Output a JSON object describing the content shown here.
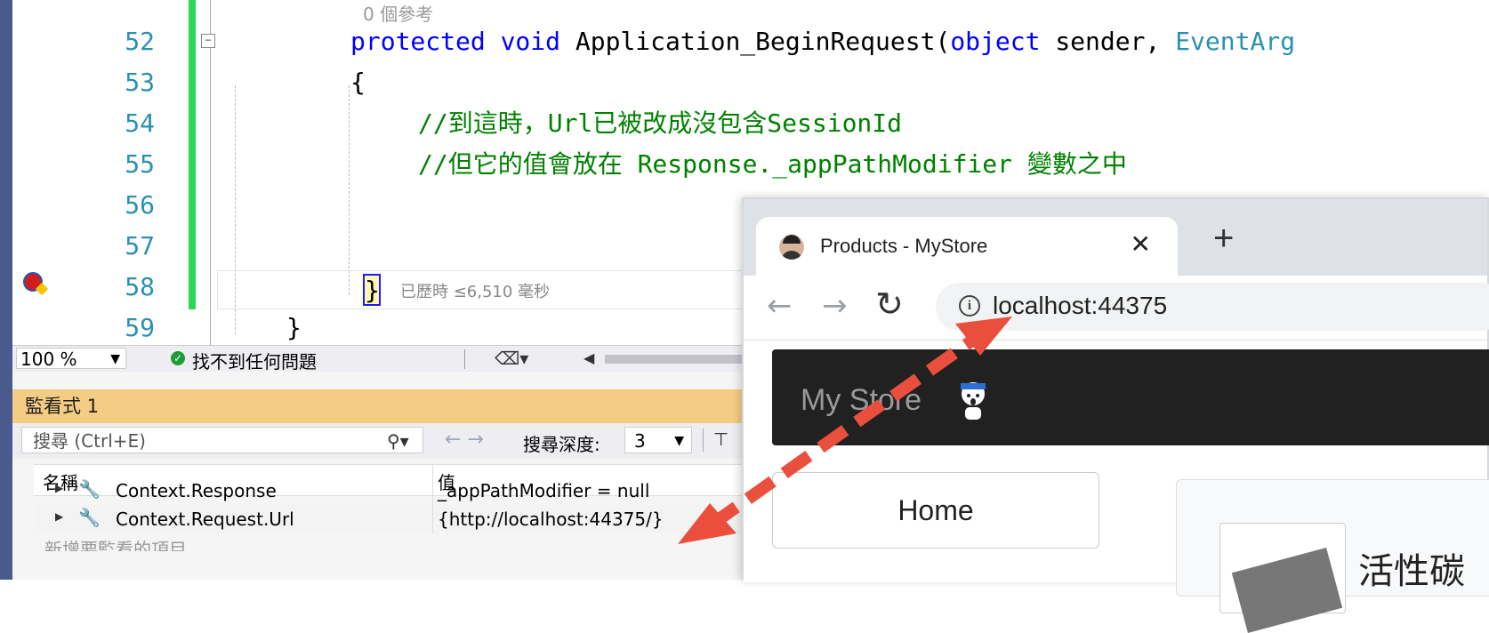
{
  "editor": {
    "codelens": "0 個參考",
    "lines": [
      {
        "no": "52",
        "text_kw1": "protected",
        "text_kw2": "void",
        "text_mid": " Application_BeginRequest(",
        "text_kw3": "object",
        "text_after": " sender, ",
        "text_type": "EventArg"
      },
      {
        "no": "53",
        "text": "{"
      },
      {
        "no": "54",
        "comment": "//到這時，Url已被改成沒包含SessionId"
      },
      {
        "no": "55",
        "comment": "//但它的值會放在 Response._appPathModifier 變數之中"
      },
      {
        "no": "56"
      },
      {
        "no": "57"
      },
      {
        "no": "58",
        "brace": "}",
        "elapsed": "已歷時 ≤6,510 毫秒"
      },
      {
        "no": "59",
        "text": "}"
      }
    ]
  },
  "statusbar": {
    "zoom": "100 %",
    "issues": "找不到任何問題"
  },
  "watch": {
    "title": "監看式 1",
    "search_placeholder": "搜尋 (Ctrl+E)",
    "depth_label": "搜尋深度:",
    "depth_value": "3",
    "col_name": "名稱",
    "col_value": "值",
    "rows": [
      {
        "name": "Context.Response",
        "value": "_appPathModifier = null"
      },
      {
        "name": "Context.Request.Url",
        "value": "{http://localhost:44375/}"
      }
    ],
    "add_item": "新增要監看的項目"
  },
  "browser": {
    "tab_title": "Products - MyStore",
    "url": "localhost:44375",
    "brand": "My Store",
    "home_button": "Home",
    "card_title": "活性碳"
  },
  "annotation": {
    "arrow_color": "#ea4f3d"
  }
}
